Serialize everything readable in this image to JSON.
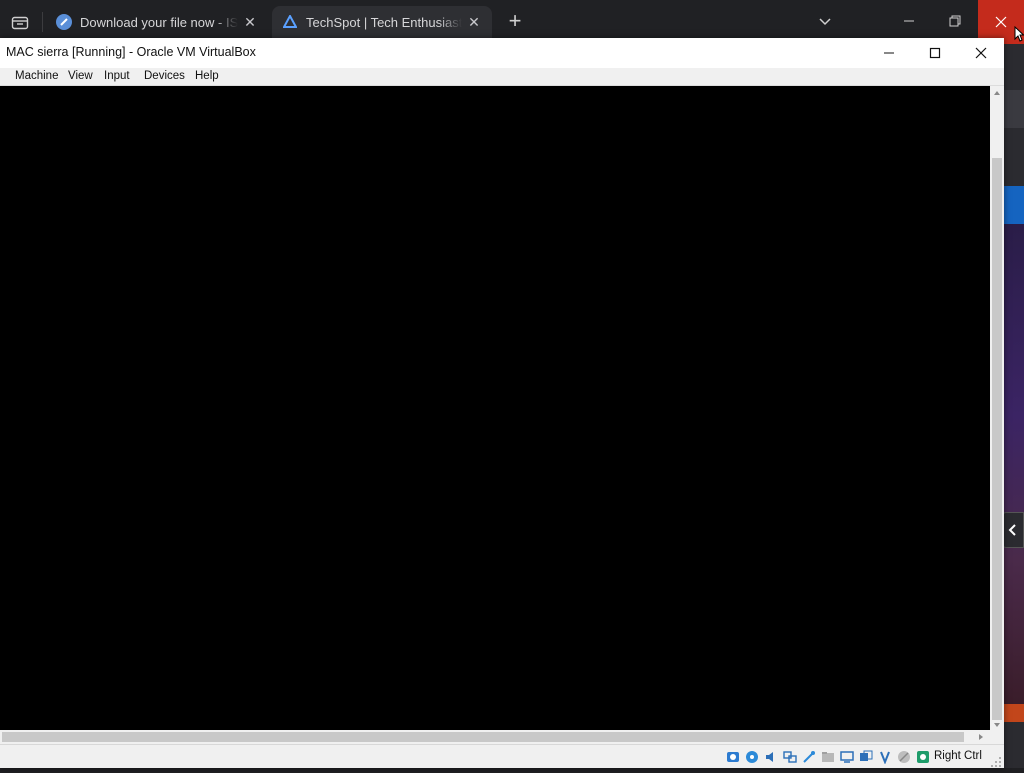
{
  "browser": {
    "tabs": [
      {
        "title": "Download your file now - ISORIVER",
        "favicon": "download-site-icon",
        "active": false
      },
      {
        "title": "TechSpot | Tech Enthusiasts, Power Users, Gamers",
        "favicon": "techspot-icon",
        "active": true
      }
    ],
    "new_tab_label": "+",
    "close_glyph": "✕"
  },
  "vbox": {
    "title": "MAC sierra [Running] - Oracle VM VirtualBox",
    "menu": [
      "Machine",
      "View",
      "Input",
      "Devices",
      "Help"
    ],
    "host_key": "Right Ctrl",
    "status_icons": [
      "hard-disk-icon",
      "optical-disk-icon",
      "audio-icon",
      "network-icon",
      "usb-icon",
      "shared-folders-icon",
      "display-icon",
      "video-capture-icon",
      "mouse-integration-icon",
      "cpu-icon",
      "keyboard-icon"
    ]
  },
  "colors": {
    "browser_bg": "#202124",
    "active_tab": "#2e2f33",
    "close_red": "#c42b1c",
    "vm_screen": "#000000",
    "vbox_chrome": "#f0f0f0"
  }
}
